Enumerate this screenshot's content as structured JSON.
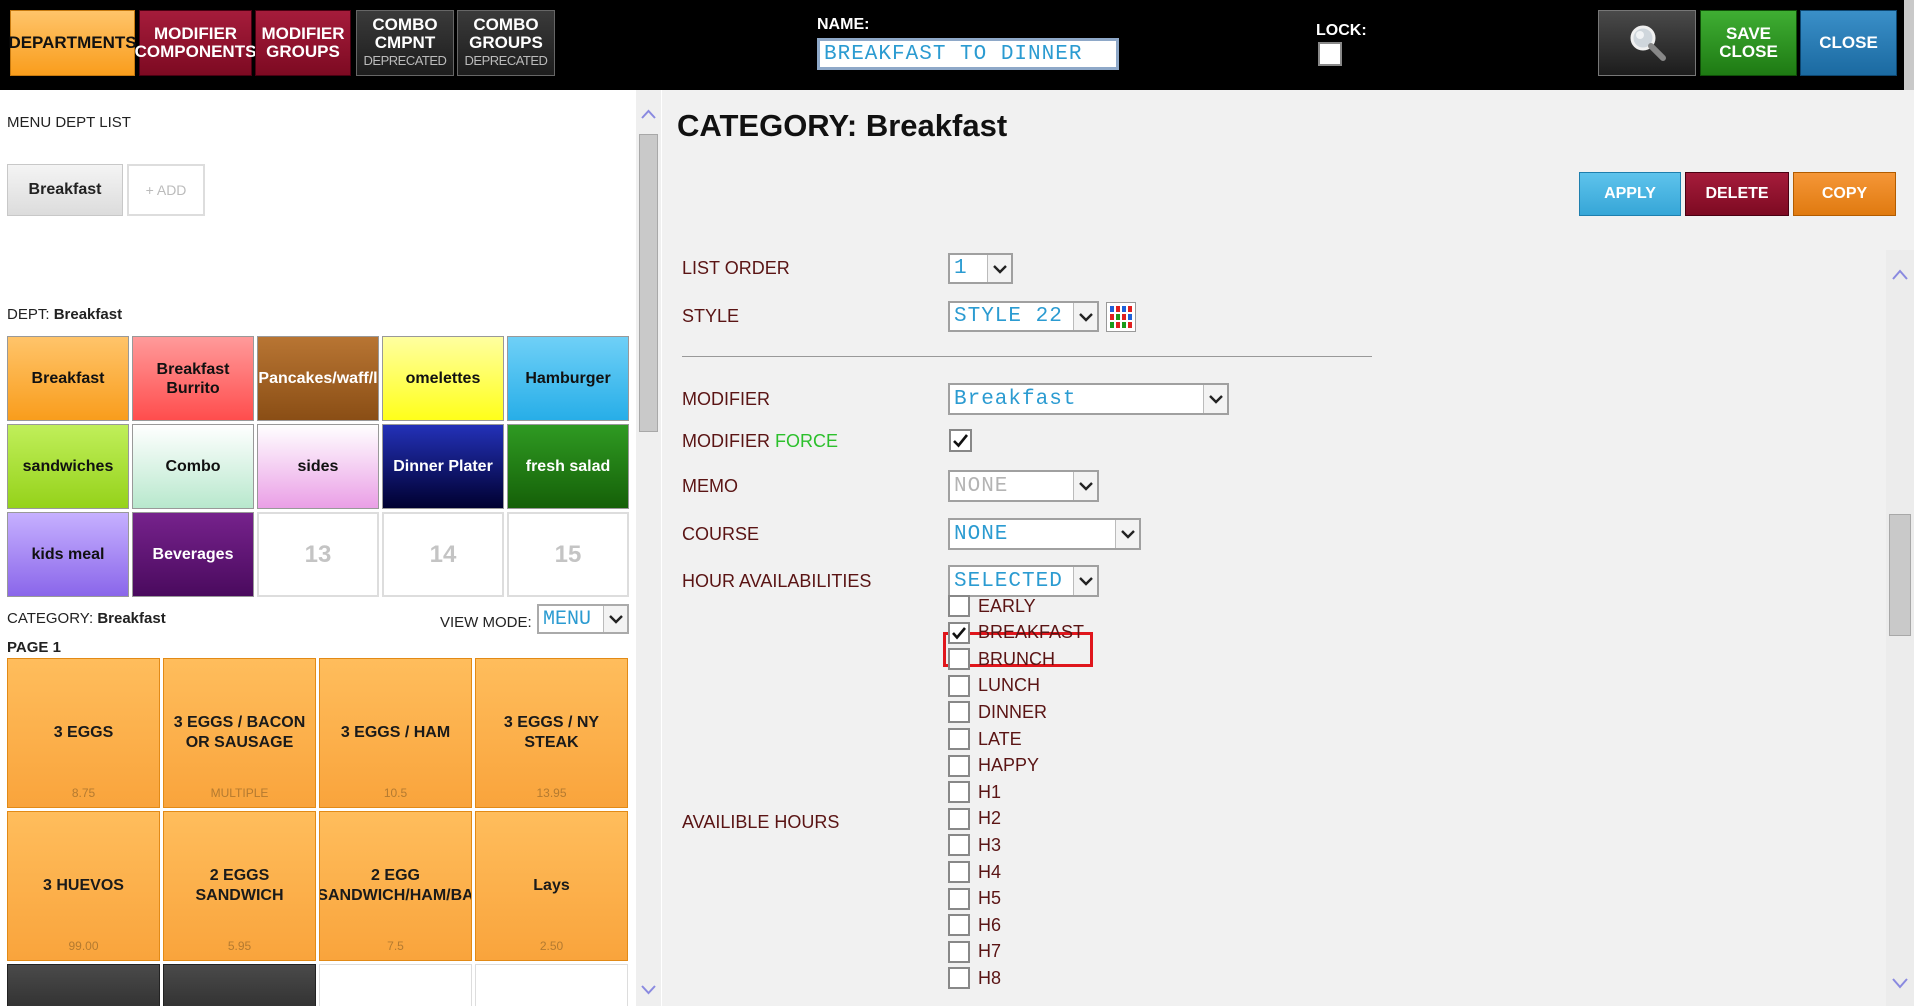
{
  "topbar": {
    "departments": "DEPARTMENTS",
    "modifier_components": "MODIFIER COMPONENTS",
    "modifier_groups": "MODIFIER GROUPS",
    "combo_cmpnt": "COMBO CMPNT",
    "combo_cmpnt_sub": "DEPRECATED",
    "combo_groups": "COMBO GROUPS",
    "combo_groups_sub": "DEPRECATED",
    "name_label": "NAME:",
    "name_value": "BREAKFAST TO DINNER",
    "lock_label": "LOCK:",
    "search_icon": "magnifier-icon",
    "save_close": "SAVE CLOSE",
    "close": "CLOSE"
  },
  "left": {
    "menu_dept_title": "MENU DEPT LIST",
    "menu_depts": [
      "Breakfast"
    ],
    "add_label": "+ ADD",
    "dept_prefix": "DEPT:",
    "dept_name": "Breakfast",
    "dept_tiles": [
      {
        "label": "Breakfast",
        "bg": "#f9a43c",
        "fg": "#111111"
      },
      {
        "label": "Breakfast Burrito",
        "bg": "#ff6b6b",
        "fg": "#111111"
      },
      {
        "label": "Pancakes/waff/l",
        "bg": "#9b5b1f",
        "fg": "#ffffff"
      },
      {
        "label": "omelettes",
        "bg": "#ffff3c",
        "fg": "#111111"
      },
      {
        "label": "Hamburger",
        "bg": "#39b6ea",
        "fg": "#111111"
      },
      {
        "label": "sandwiches",
        "bg": "#a3e02a",
        "fg": "#111111"
      },
      {
        "label": "Combo",
        "bg": "#d8f3e4",
        "fg": "#111111"
      },
      {
        "label": "sides",
        "bg": "#f3c8f1",
        "fg": "#111111"
      },
      {
        "label": "Dinner Plater",
        "bg": "#0a1880",
        "fg": "#ffffff"
      },
      {
        "label": "fresh salad",
        "bg": "#1d7a12",
        "fg": "#ffffff"
      },
      {
        "label": "kids meal",
        "bg": "#a98bf0",
        "fg": "#111111"
      },
      {
        "label": "Beverages",
        "bg": "#5d1172",
        "fg": "#ffffff"
      },
      {
        "label": "13",
        "bg": "#ffffff",
        "fg": "#c4c4c4",
        "empty": true
      },
      {
        "label": "14",
        "bg": "#ffffff",
        "fg": "#c4c4c4",
        "empty": true
      },
      {
        "label": "15",
        "bg": "#ffffff",
        "fg": "#c4c4c4",
        "empty": true
      }
    ],
    "category_prefix": "CATEGORY:",
    "category_name": "Breakfast",
    "view_mode_label": "VIEW MODE:",
    "view_mode_value": "MENU",
    "page_label": "PAGE 1",
    "items": [
      {
        "name": "3 EGGS",
        "price": "8.75"
      },
      {
        "name": "3 EGGS / BACON OR SAUSAGE",
        "price": "MULTIPLE"
      },
      {
        "name": "3 EGGS / HAM",
        "price": "10.5"
      },
      {
        "name": "3 EGGS / NY STEAK",
        "price": "13.95"
      },
      {
        "name": "3 HUEVOS",
        "price": "99.00"
      },
      {
        "name": "2 EGGS SANDWICH",
        "price": "5.95"
      },
      {
        "name": "2 EGG SANDWICH/HAM/BA",
        "price": "7.5"
      },
      {
        "name": "Lays",
        "price": "2.50"
      }
    ]
  },
  "right": {
    "title": "CATEGORY: Breakfast",
    "apply": "APPLY",
    "delete": "DELETE",
    "copy": "COPY",
    "list_order_label": "LIST ORDER",
    "list_order_value": "1",
    "style_label": "STYLE",
    "style_value": "STYLE 22",
    "modifier_label": "MODIFIER",
    "modifier_value": "Breakfast",
    "modifier_force_a": "MODIFIER ",
    "modifier_force_b": "FORCE",
    "memo_label": "MEMO",
    "memo_value": "NONE",
    "course_label": "COURSE",
    "course_value": "NONE",
    "hour_avail_label": "HOUR AVAILABILITIES",
    "hour_avail_value": "SELECTED",
    "available_hours_label": "AVAILIBLE HOURS",
    "hours": [
      {
        "label": "EARLY",
        "checked": false
      },
      {
        "label": "BREAKFAST",
        "checked": true
      },
      {
        "label": "BRUNCH",
        "checked": false
      },
      {
        "label": "LUNCH",
        "checked": false
      },
      {
        "label": "DINNER",
        "checked": false
      },
      {
        "label": "LATE",
        "checked": false
      },
      {
        "label": "HAPPY",
        "checked": false
      },
      {
        "label": "H1",
        "checked": false
      },
      {
        "label": "H2",
        "checked": false
      },
      {
        "label": "H3",
        "checked": false
      },
      {
        "label": "H4",
        "checked": false
      },
      {
        "label": "H5",
        "checked": false
      },
      {
        "label": "H6",
        "checked": false
      },
      {
        "label": "H7",
        "checked": false
      },
      {
        "label": "H8",
        "checked": false
      }
    ]
  },
  "colors": {
    "accent_orange": "#f9a43c",
    "accent_blue": "#2b9bd1",
    "label_brown": "#5a1414",
    "highlight_red": "#e0161c"
  }
}
